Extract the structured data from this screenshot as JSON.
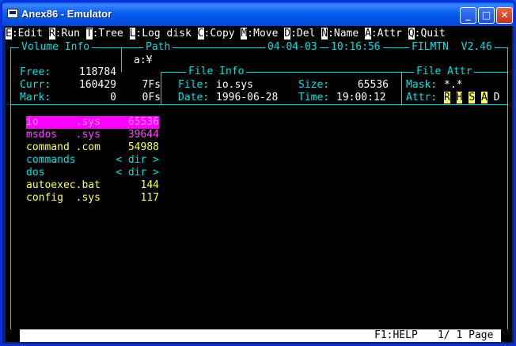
{
  "window": {
    "title": "Anex86 - Emulator"
  },
  "title_buttons": {
    "minimize": "_",
    "maximize": "□",
    "close": "✕"
  },
  "menu": [
    {
      "key": "E",
      "label": ":Edit "
    },
    {
      "key": "R",
      "label": ":Run "
    },
    {
      "key": "T",
      "label": ":Tree "
    },
    {
      "key": "L",
      "label": ":Log disk "
    },
    {
      "key": "C",
      "label": ":Copy "
    },
    {
      "key": "M",
      "label": ":Move "
    },
    {
      "key": "D",
      "label": ":Del "
    },
    {
      "key": "N",
      "label": ":Name "
    },
    {
      "key": "A",
      "label": ":Attr "
    },
    {
      "key": "Q",
      "label": ":Quit"
    }
  ],
  "header": {
    "volume_info": "Volume Info",
    "path_label": "Path",
    "date": "04-04-03",
    "time": "10:16:56",
    "app": "FILMTN  V2.46",
    "path": "a:¥"
  },
  "volume": {
    "free_label": "Free:",
    "free": "118784",
    "curr_label": "Curr:",
    "curr": "160429",
    "curr_fs": "7Fs",
    "mark_label": "Mark:",
    "mark": "0",
    "mark_fs": "0Fs"
  },
  "file_info": {
    "title": "File Info",
    "file_label": "File:",
    "file": "io.sys",
    "size_label": "Size:",
    "size": "65536",
    "date_label": "Date:",
    "date": "1996-06-28",
    "time_label": "Time:",
    "time": "19:00:12"
  },
  "file_attr": {
    "title": "File Attr",
    "mask_label": "Mask:",
    "mask": "*.*",
    "attr_label": "Attr:",
    "flags": [
      "R",
      "H",
      "S",
      "A"
    ],
    "flag_d": "D"
  },
  "files": [
    {
      "name": "io      .sys",
      "size": "65536",
      "color": "#ff44ff",
      "selected": true
    },
    {
      "name": "msdos   .sys",
      "size": "39644",
      "color": "#ff44ff"
    },
    {
      "name": "command .com",
      "size": "54988",
      "color": "#ffff55"
    },
    {
      "name": "commands",
      "size": "< dir >",
      "color": "#00e0e0"
    },
    {
      "name": "dos",
      "size": "< dir >",
      "color": "#00e0e0"
    },
    {
      "name": "autoexec.bat",
      "size": "144",
      "color": "#ffff55"
    },
    {
      "name": "config  .sys",
      "size": "117",
      "color": "#ffff55"
    }
  ],
  "status": {
    "help": "F1:HELP",
    "page": "1/ 1 Page"
  }
}
